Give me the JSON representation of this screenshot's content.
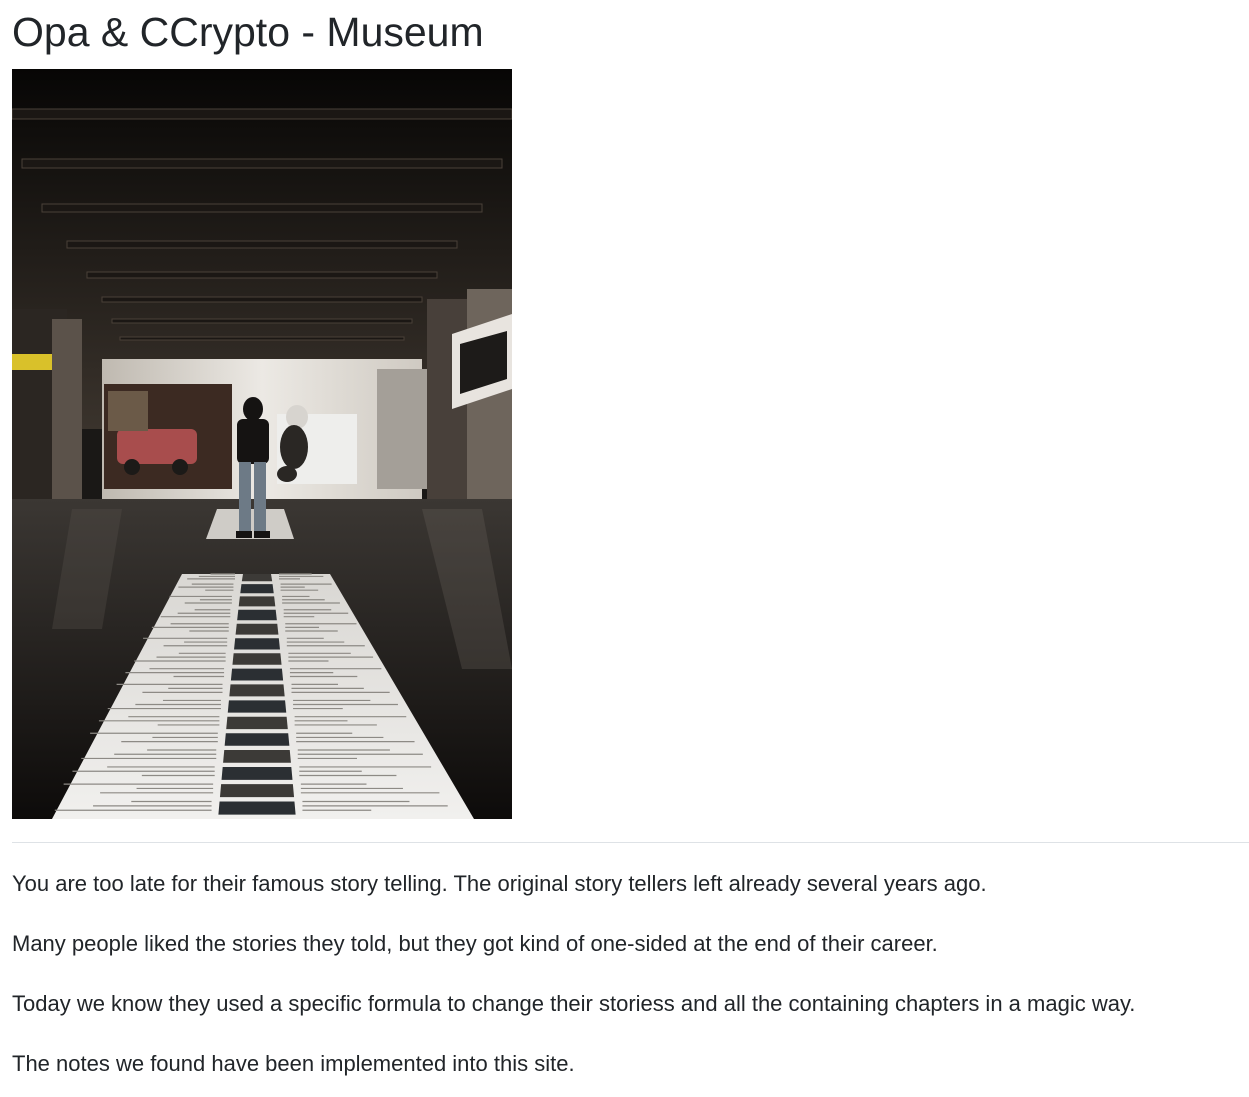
{
  "page": {
    "title": "Opa & CCrypto - Museum"
  },
  "hero_image": {
    "subject": "person standing in a dark museum hall looking down a long paper timeline on the floor",
    "tone": "grayscale-warm"
  },
  "story": {
    "paragraphs": [
      "You are too late for their famous story telling. The original story tellers left already several years ago.",
      "Many people liked the stories they told, but they got kind of one-sided at the end of their career.",
      "Today we know they used a specific formula to change their storiess and all the containing chapters in a magic way.",
      "The notes we found have been implemented into this site."
    ]
  },
  "colors": {
    "text": "#212529",
    "divider": "#dee2e6",
    "background": "#ffffff"
  }
}
